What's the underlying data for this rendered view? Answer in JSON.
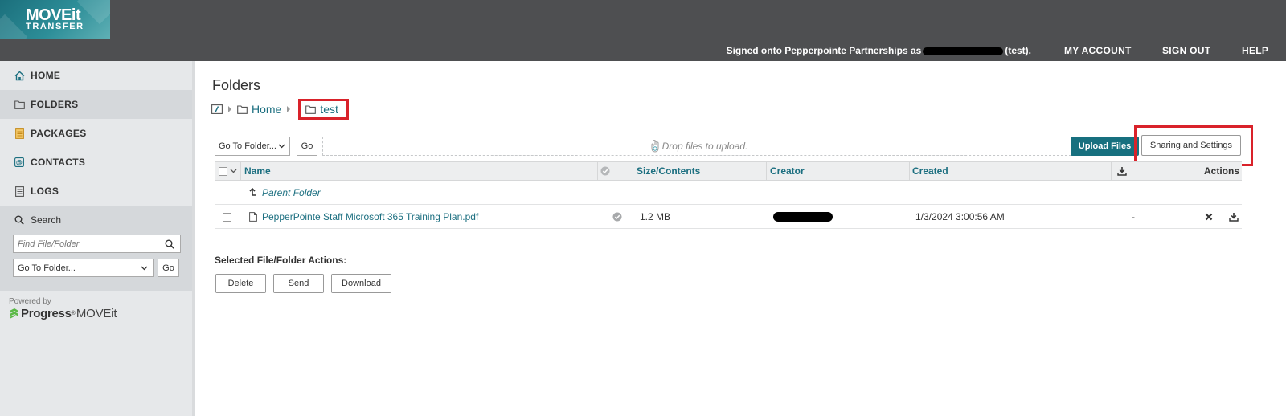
{
  "header": {
    "logo_main": "MOVEit",
    "logo_sub": "TRANSFER",
    "signed_prefix": "Signed onto",
    "org": "Pepperpointe Partnerships",
    "as_word": "as",
    "user_suffix": "(test).",
    "links": [
      "MY ACCOUNT",
      "SIGN OUT",
      "HELP"
    ]
  },
  "sidebar": {
    "items": [
      {
        "label": "HOME",
        "icon": "home-icon"
      },
      {
        "label": "FOLDERS",
        "icon": "folder-icon"
      },
      {
        "label": "PACKAGES",
        "icon": "package-icon"
      },
      {
        "label": "CONTACTS",
        "icon": "contacts-icon"
      },
      {
        "label": "LOGS",
        "icon": "logs-icon"
      }
    ],
    "search_label": "Search",
    "find_placeholder": "Find File/Folder",
    "goto_label": "Go To Folder...",
    "go_label": "Go",
    "powered_by": "Powered by",
    "progress_brand": "Progress",
    "progress_product": "MOVEit"
  },
  "main": {
    "title": "Folders",
    "breadcrumb": {
      "home": "Home",
      "current": "test"
    },
    "toolbar": {
      "goto_label": "Go To Folder...",
      "go_label": "Go",
      "drop_text": "Drop files to upload.",
      "upload_label": "Upload Files",
      "sharing_label": "Sharing and Settings"
    },
    "table": {
      "headers": {
        "name": "Name",
        "size": "Size/Contents",
        "creator": "Creator",
        "created": "Created",
        "actions": "Actions"
      },
      "parent_label": "Parent Folder",
      "rows": [
        {
          "name": "PepperPointe Staff Microsoft 365 Training Plan.pdf",
          "size": "1.2 MB",
          "created": "1/3/2024 3:00:56 AM",
          "downloads": "-"
        }
      ]
    },
    "selected_actions_title": "Selected File/Folder Actions:",
    "action_buttons": [
      "Delete",
      "Send",
      "Download"
    ]
  },
  "colors": {
    "header_bg": "#4e4f51",
    "accent_teal": "#17707f",
    "link_teal": "#1c6f80",
    "highlight_red": "#d9222a",
    "sidebar_bg": "#e6e8ea"
  }
}
